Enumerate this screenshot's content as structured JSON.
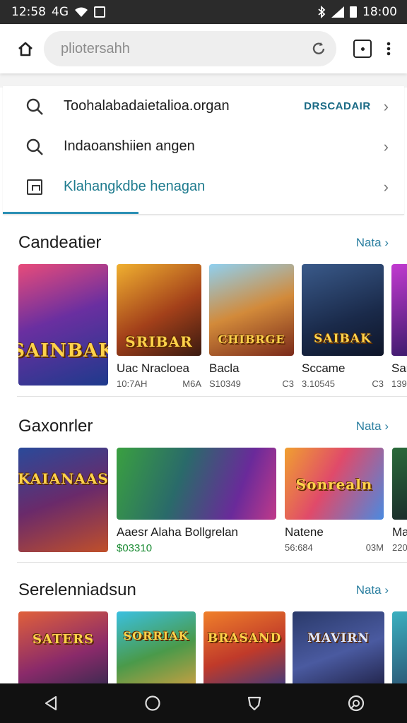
{
  "status_bar": {
    "time": "12:58",
    "network": "4G",
    "right_text": "18:00",
    "icons": [
      "wifi-icon",
      "notification-box-icon",
      "bluetooth-icon",
      "signal-icon",
      "battery-icon"
    ]
  },
  "topbar": {
    "search_placeholder": "pliotersahh",
    "icons": [
      "home-icon",
      "reload-icon",
      "tabs-icon",
      "more-vert-icon"
    ]
  },
  "suggestions": [
    {
      "icon": "search-icon",
      "text": "Toohalabadaietalioa.organ",
      "tag": "DRSCADAIR"
    },
    {
      "icon": "search-icon",
      "text": "Indaoanshiien angen",
      "tag": ""
    },
    {
      "icon": "page-icon",
      "text": "Klahangkdbe henagan",
      "tag": ""
    }
  ],
  "sections": [
    {
      "title": "Candeatier",
      "more": "Nata",
      "cards": [
        {
          "logo": "SAINBAK",
          "name": "",
          "meta_left": "",
          "meta_right": ""
        },
        {
          "logo": "SRIBAR",
          "name": "Uac Nracloea",
          "meta_left": "10:7AH",
          "meta_right": "M6A"
        },
        {
          "logo": "CHIBRGE",
          "name": "Bacla",
          "meta_left": "S10349",
          "meta_right": "C3"
        },
        {
          "logo": "SAIBAK",
          "name": "Sccame",
          "meta_left": "3.10545",
          "meta_right": "C3"
        },
        {
          "logo": "",
          "name": "Sar",
          "meta_left": "139",
          "meta_right": ""
        }
      ]
    },
    {
      "title": "Gaxonrler",
      "more": "Nata",
      "cards": [
        {
          "logo": "KAIANAAS",
          "name": "",
          "meta_left": "",
          "meta_right": ""
        },
        {
          "logo": "",
          "name": "Aaesr Alaha Bollgrelan",
          "meta_left": "$03310",
          "meta_right": ""
        },
        {
          "logo": "Sonrealn",
          "name": "Natene",
          "meta_left": "56:684",
          "meta_right": "03M"
        },
        {
          "logo": "",
          "name": "Ma",
          "meta_left": "220",
          "meta_right": ""
        }
      ]
    },
    {
      "title": "Serelenniadsun",
      "more": "Nata",
      "cards": [
        {
          "logo": "SATERS",
          "name": "",
          "meta_left": "",
          "meta_right": ""
        },
        {
          "logo": "SORRIAK",
          "name": "",
          "meta_left": "",
          "meta_right": ""
        },
        {
          "logo": "BRASAND",
          "name": "",
          "meta_left": "",
          "meta_right": ""
        },
        {
          "logo": "MAVIRN",
          "name": "",
          "meta_left": "",
          "meta_right": ""
        }
      ]
    }
  ],
  "navbar": {
    "icons": [
      "back-icon",
      "home-circle-icon",
      "recents-icon",
      "assistant-icon"
    ]
  },
  "colors": {
    "link": "#2b7fa0",
    "price": "#1b8c34",
    "status_bg": "#2b2b2b",
    "nav_bg": "#111111"
  }
}
